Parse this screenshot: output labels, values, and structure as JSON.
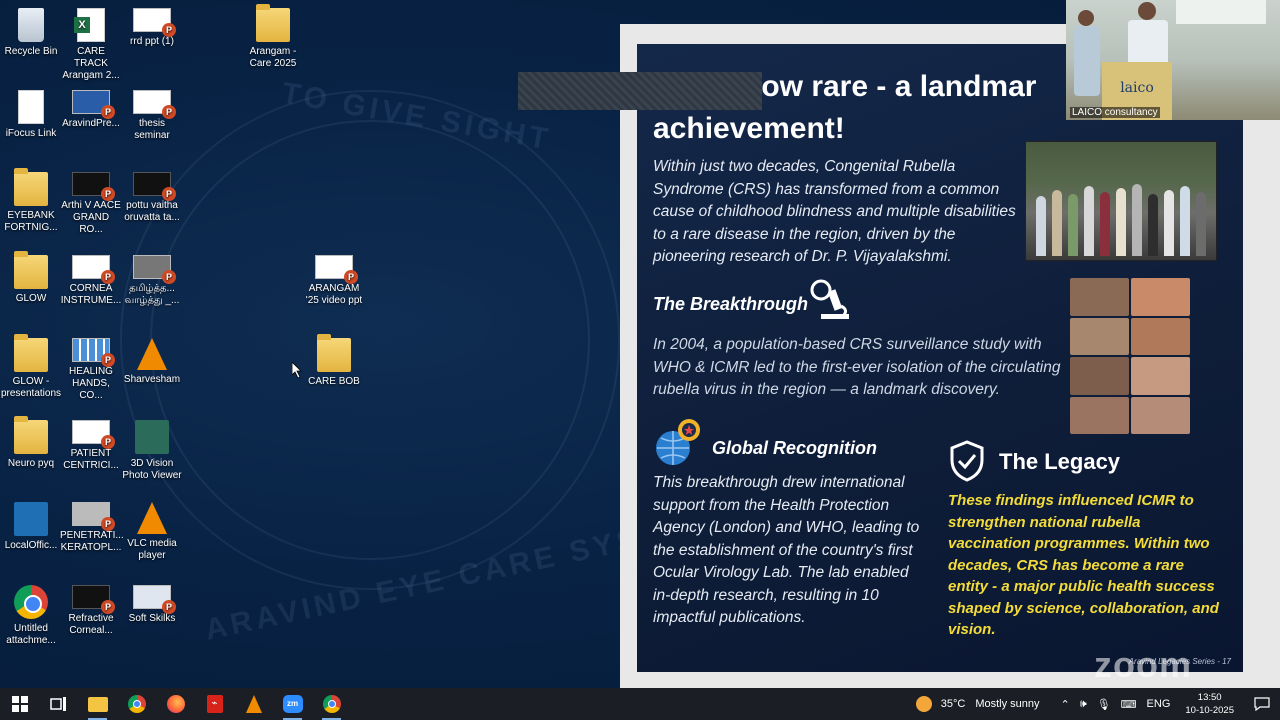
{
  "desktop": {
    "icons": [
      {
        "label": "Recycle Bin",
        "icon": "recycle-bin-icon"
      },
      {
        "label": "CARE TRACK Arangam 2...",
        "icon": "excel-file-icon"
      },
      {
        "label": "rrd ppt (1)",
        "icon": "powerpoint-file-icon"
      },
      {
        "label": "Arangam - Care 2025",
        "icon": "folder-icon"
      },
      {
        "label": "iFocus Link",
        "icon": "text-file-icon"
      },
      {
        "label": "AravindPre...",
        "icon": "powerpoint-file-icon"
      },
      {
        "label": "thesis seminar",
        "icon": "powerpoint-file-icon"
      },
      {
        "label": "EYEBANK FORTNIG...",
        "icon": "folder-icon"
      },
      {
        "label": "Arthi V AACE GRAND RO...",
        "icon": "powerpoint-file-icon"
      },
      {
        "label": "pottu vaitha oruvatta ta...",
        "icon": "powerpoint-file-icon"
      },
      {
        "label": "GLOW",
        "icon": "folder-icon"
      },
      {
        "label": "CORNEA INSTRUME...",
        "icon": "powerpoint-file-icon"
      },
      {
        "label": "தமிழ்த்த... வாழ்த்து _...",
        "icon": "powerpoint-file-icon"
      },
      {
        "label": "ARANGAM '25 video ppt",
        "icon": "powerpoint-file-icon"
      },
      {
        "label": "GLOW - presentations",
        "icon": "folder-icon"
      },
      {
        "label": "HEALING HANDS, CO...",
        "icon": "powerpoint-file-icon"
      },
      {
        "label": "Sharvesham",
        "icon": "vlc-icon"
      },
      {
        "label": "CARE BOB",
        "icon": "folder-icon"
      },
      {
        "label": "Neuro pyq",
        "icon": "folder-icon"
      },
      {
        "label": "PATIENT CENTRICI...",
        "icon": "powerpoint-file-icon"
      },
      {
        "label": "3D Vision Photo Viewer",
        "icon": "photo-viewer-icon"
      },
      {
        "label": "LocalOffic...",
        "icon": "localoffice-icon"
      },
      {
        "label": "PENETRATI... KERATOPL...",
        "icon": "powerpoint-file-icon"
      },
      {
        "label": "VLC media player",
        "icon": "vlc-icon"
      },
      {
        "label": "Untitled attachme...",
        "icon": "chrome-icon"
      },
      {
        "label": "Refractive Corneal...",
        "icon": "powerpoint-file-icon"
      },
      {
        "label": "Soft Skilks",
        "icon": "powerpoint-file-icon"
      }
    ]
  },
  "slide": {
    "title_line1": "CRS - now rare - a landmar",
    "title_line2": "achievement!",
    "intro": "Within just two decades, Congenital Rubella Syndrome (CRS) has transformed from a common cause of childhood blindness and multiple disabilities to a rare disease in the region, driven by the pioneering research of Dr. P. Vijayalakshmi.",
    "breakthrough_heading": "The Breakthrough",
    "breakthrough_text": "In 2004, a population-based CRS surveillance study with WHO & ICMR led to the first-ever isolation of the circulating rubella virus in the region — a landmark discovery.",
    "global_heading": "Global Recognition",
    "global_text": "This breakthrough drew international support from the Health Protection Agency (London) and WHO, leading to the establishment of the country's first Ocular Virology Lab. The lab enabled in-depth research, resulting in 10 impactful publications.",
    "legacy_heading": "The Legacy",
    "legacy_text": "These findings influenced ICMR to strengthen national rubella vaccination programmes. Within two decades, CRS has become a rare entity - a major public health success shaped by science, collaboration, and vision.",
    "footer": "Aravind Legacies Series - 17"
  },
  "webcam": {
    "label": "LAICO consultancy",
    "podium_text": "laico"
  },
  "zoom_watermark": "zoom",
  "taskbar": {
    "apps": [
      "start-icon",
      "task-view-icon",
      "file-explorer-icon",
      "chrome-icon",
      "firefox-icon",
      "acrobat-icon",
      "vlc-icon",
      "zoom-icon",
      "chrome-icon"
    ],
    "weather_temp": "35°C",
    "weather_desc": "Mostly sunny",
    "language": "ENG",
    "time": "13:50",
    "date": "10-10-2025"
  }
}
